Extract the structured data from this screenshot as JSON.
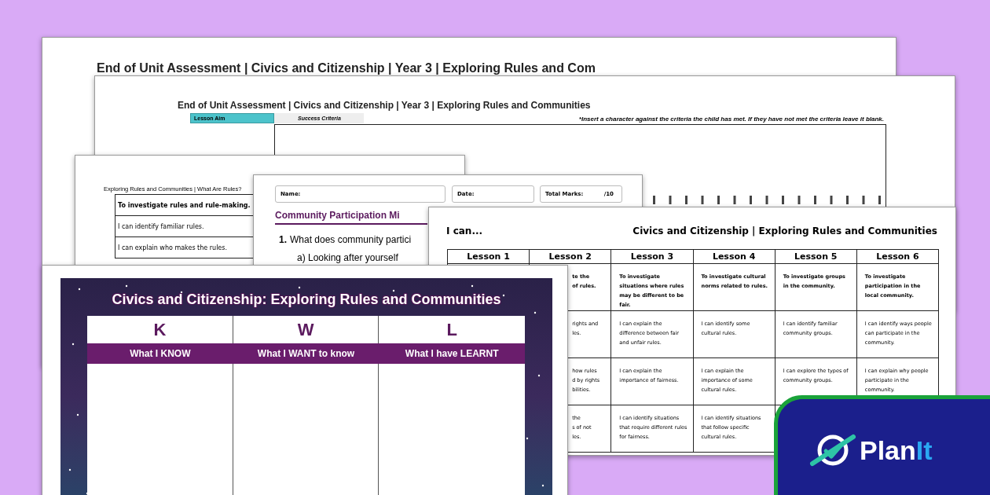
{
  "back_sheet": {
    "title": "End of Unit Assessment | Civics and Citizenship | Year 3 | Exploring Rules and Com"
  },
  "assessment_sheet": {
    "title": "End of Unit Assessment | Civics and Citizenship | Year 3 | Exploring Rules and Communities",
    "lesson_aim_label": "Lesson Aim",
    "success_criteria_label": "Success Criteria",
    "note": "*Insert a character against the criteria the child has met. If they have not met the criteria leave it blank."
  },
  "rules_sheet": {
    "title": "Exploring Rules and Communities | What Are Rules?",
    "rows": [
      {
        "kind": "aim",
        "text": "To investigate rules and rule-making."
      },
      {
        "kind": "criterion",
        "text": "I can identify familiar rules."
      },
      {
        "kind": "criterion",
        "text": "I can explain who makes the rules."
      }
    ]
  },
  "quiz_sheet": {
    "fields": [
      {
        "label": "Name:"
      },
      {
        "label": "Date:"
      },
      {
        "label": "Total Marks:",
        "value": "/10"
      }
    ],
    "heading": "Community Participation Mi",
    "question_number": "1.",
    "question": "What does community partici",
    "option": "a) Looking after yourself"
  },
  "i_can_sheet": {
    "heading": "I can...",
    "title": "Civics and Citizenship | Exploring Rules and Communities",
    "columns": [
      {
        "header": "Lesson 1"
      },
      {
        "header": "Lesson 2",
        "cells": [
          {
            "kind": "aim",
            "text": "te the\nof rules."
          },
          {
            "kind": "criterion",
            "text": "rights and\nles."
          },
          {
            "kind": "criterion",
            "text": "how rules\nd by rights\nbilities."
          },
          {
            "kind": "criterion",
            "text": "the\ns of not\nles."
          }
        ]
      },
      {
        "header": "Lesson 3",
        "cells": [
          {
            "kind": "aim",
            "text": "To investigate situations where rules may be different to be fair."
          },
          {
            "kind": "criterion",
            "text": "I can explain the difference between fair and unfair rules."
          },
          {
            "kind": "criterion",
            "text": "I can explain the importance of fairness."
          },
          {
            "kind": "criterion",
            "text": "I can identify situations that require different rules for fairness."
          }
        ]
      },
      {
        "header": "Lesson 4",
        "cells": [
          {
            "kind": "aim",
            "text": "To investigate cultural norms related to rules."
          },
          {
            "kind": "criterion",
            "text": "I can identify some cultural rules."
          },
          {
            "kind": "criterion",
            "text": "I can explain the importance of some cultural rules."
          },
          {
            "kind": "criterion",
            "text": "I can identify situations that follow specific cultural rules."
          }
        ]
      },
      {
        "header": "Lesson 5",
        "cells": [
          {
            "kind": "aim",
            "text": "To investigate groups in the community."
          },
          {
            "kind": "criterion",
            "text": "I can identify familiar community groups."
          },
          {
            "kind": "criterion",
            "text": "I can explore the types of community groups."
          }
        ]
      },
      {
        "header": "Lesson 6",
        "cells": [
          {
            "kind": "aim",
            "text": "To investigate participation in the local community."
          },
          {
            "kind": "criterion",
            "text": "I can identify ways people can participate in the community."
          },
          {
            "kind": "criterion",
            "text": "I can explain why people participate in the community."
          }
        ]
      }
    ]
  },
  "kwl_sheet": {
    "title": "Civics and Citizenship: Exploring Rules and Communities",
    "columns": [
      {
        "letter": "K",
        "caption": "What I KNOW"
      },
      {
        "letter": "W",
        "caption": "What I WANT to know"
      },
      {
        "letter": "L",
        "caption": "What I have LEARNT"
      }
    ]
  },
  "logo": {
    "text": "Plan",
    "accent": "It"
  }
}
